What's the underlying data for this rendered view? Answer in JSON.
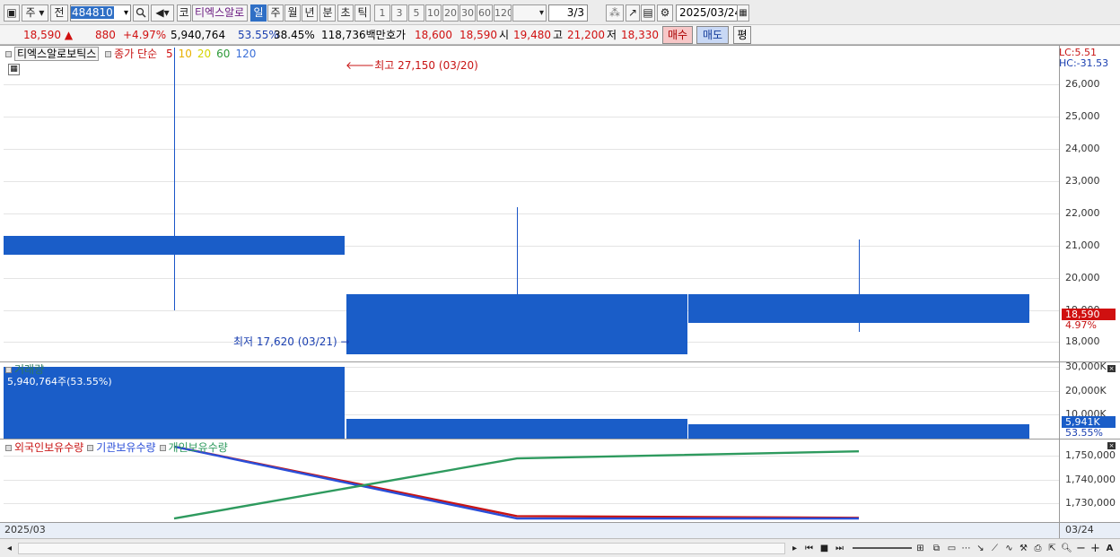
{
  "toolbar": {
    "market_select": "주",
    "prev_label": "전",
    "code": "484810",
    "name": "티엑스알로",
    "period_tabs": [
      "일",
      "주",
      "월",
      "년",
      "분",
      "초",
      "틱"
    ],
    "active_period": "일",
    "code_prefix": "코",
    "interval_buttons": [
      "1",
      "3",
      "5",
      "10",
      "20",
      "30",
      "60",
      "120"
    ],
    "page": "3/3",
    "date": "2025/03/24"
  },
  "quote": {
    "price": "18,590",
    "change_arrow": "▲",
    "change": "880",
    "change_pct": "+4.97%",
    "volume": "5,940,764",
    "volume_ratio": "53.55%",
    "turnover": "38.45%",
    "amount": "118,736백만",
    "hoga_label": "호가",
    "ask": "18,600",
    "bid": "18,590",
    "open_label": "시",
    "open": "19,480",
    "high_label": "고",
    "high": "21,200",
    "low_label": "저",
    "low": "18,330",
    "buy_button": "매수",
    "sell_button": "매도",
    "eval_button": "평"
  },
  "price_panel": {
    "legend_name": "티엑스알로보틱스",
    "legend_ma": "종가 단순",
    "ma_periods": [
      {
        "label": "5",
        "color": "#d01010"
      },
      {
        "label": "10",
        "color": "#e8b000"
      },
      {
        "label": "20",
        "color": "#d4d400"
      },
      {
        "label": "60",
        "color": "#2f9a3a"
      },
      {
        "label": "120",
        "color": "#3a6fd8"
      }
    ],
    "high_annotation": "최고 27,150 (03/20)",
    "low_annotation": "최저 17,620 (03/21)",
    "lc": "LC:5.51",
    "hc": "HC:-31.53",
    "y_ticks": [
      "26,000",
      "25,000",
      "24,000",
      "23,000",
      "22,000",
      "21,000",
      "20,000",
      "19,000",
      "18,000"
    ],
    "current_tag": "18,590",
    "current_pct": "4.97%"
  },
  "volume_panel": {
    "title": "거래량",
    "value_label": "5,940,764주(53.55%)",
    "y_ticks": [
      "30,000K",
      "20,000K",
      "10,000K"
    ],
    "current_tag": "5,941K",
    "current_pct": "53.55%"
  },
  "holding_panel": {
    "series": [
      {
        "name": "외국인보유수량",
        "color": "#c81414"
      },
      {
        "name": "기관보유수량",
        "color": "#2a4ed8"
      },
      {
        "name": "개인보유수량",
        "color": "#2e9a5e"
      }
    ],
    "y_ticks": [
      "1,750,000",
      "1,740,000",
      "1,730,000"
    ]
  },
  "x_axis": {
    "left_label": "2025/03",
    "right_label": "03/24"
  },
  "chart_data": [
    {
      "type": "candlestick",
      "title": "티엑스알로보틱스",
      "categories": [
        "03/20",
        "03/21",
        "03/24"
      ],
      "open": [
        21300,
        17620,
        19480
      ],
      "high": [
        27150,
        22200,
        21200
      ],
      "low": [
        19000,
        17620,
        18330
      ],
      "close": [
        20700,
        19500,
        18590
      ],
      "ylim": [
        17400,
        27200
      ]
    },
    {
      "type": "bar",
      "title": "거래량",
      "categories": [
        "03/20",
        "03/21",
        "03/24"
      ],
      "values": [
        30000000,
        8200000,
        5940764
      ],
      "ylim": [
        0,
        32000000
      ]
    },
    {
      "type": "line",
      "categories": [
        "03/20",
        "03/21",
        "03/24"
      ],
      "series": [
        {
          "name": "외국인보유수량",
          "values": [
            1754000,
            1724500,
            1723800
          ]
        },
        {
          "name": "기관보유수량",
          "values": [
            1754000,
            1723500,
            1723500
          ]
        },
        {
          "name": "개인보유수량",
          "values": [
            1723500,
            1749000,
            1752000
          ]
        }
      ],
      "ylim": [
        1722000,
        1757000
      ]
    }
  ]
}
